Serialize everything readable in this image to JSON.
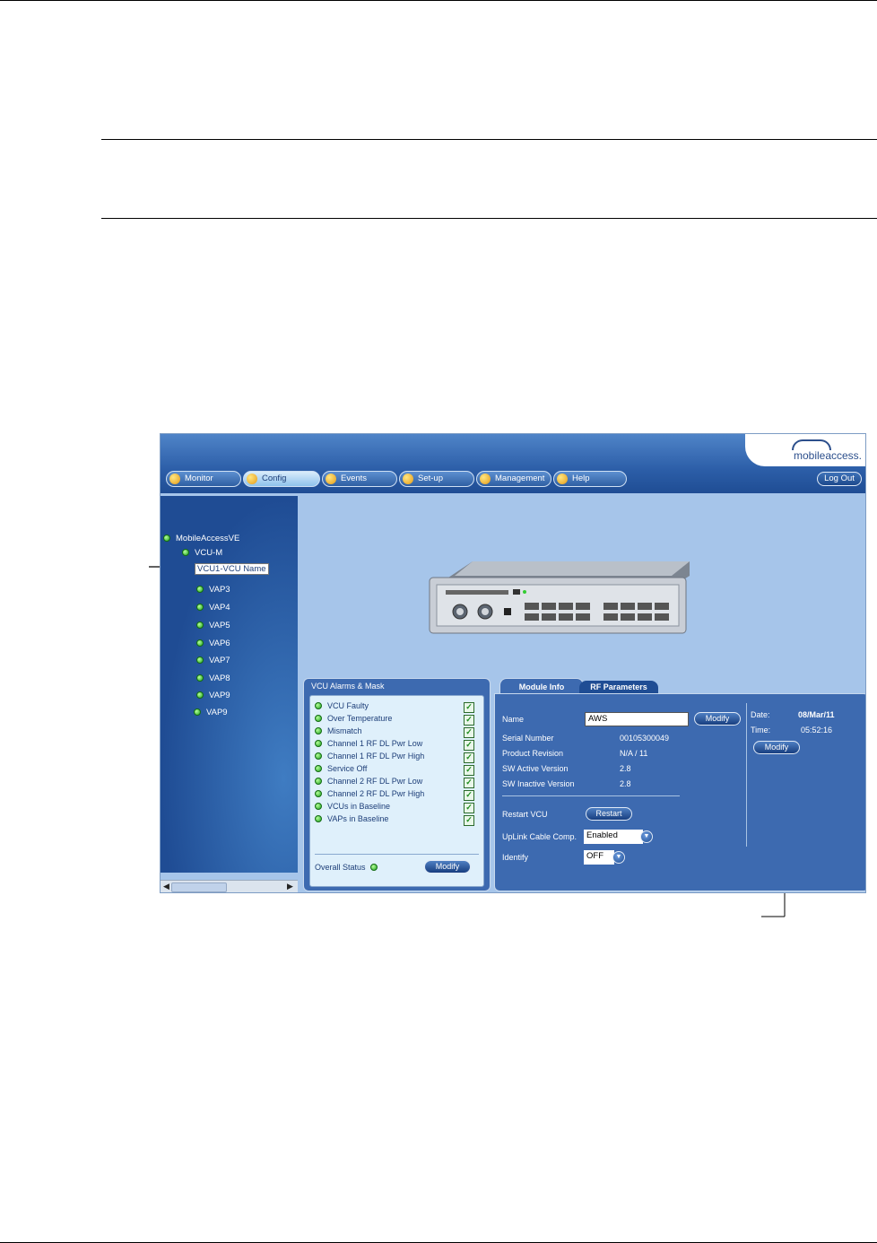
{
  "tabs": [
    {
      "label": "Monitor"
    },
    {
      "label": "Config"
    },
    {
      "label": "Events"
    },
    {
      "label": "Set-up"
    },
    {
      "label": "Management"
    },
    {
      "label": "Help"
    }
  ],
  "logo_text": "mobileaccess.",
  "logout_label": "Log Out",
  "tree": {
    "root": "MobileAccessVE",
    "vcu_m": "VCU-M",
    "selected": "VCU1-VCU Name",
    "vaps": [
      "VAP3",
      "VAP4",
      "VAP5",
      "VAP6",
      "VAP7",
      "VAP8",
      "VAP9",
      "VAP9"
    ]
  },
  "alarms": {
    "title": "VCU Alarms & Mask",
    "items": [
      {
        "label": "VCU Faulty",
        "checked": true
      },
      {
        "label": "Over Temperature",
        "checked": true
      },
      {
        "label": "Mismatch",
        "checked": true
      },
      {
        "label": "Channel 1 RF DL Pwr Low",
        "checked": true
      },
      {
        "label": "Channel 1 RF DL Pwr High",
        "checked": true
      },
      {
        "label": "Service Off",
        "checked": true
      },
      {
        "label": "Channel 2 RF DL Pwr Low",
        "checked": true
      },
      {
        "label": "Channel 2 RF DL Pwr High",
        "checked": true
      },
      {
        "label": "VCUs in Baseline",
        "checked": true
      },
      {
        "label": "VAPs in Baseline",
        "checked": true
      }
    ],
    "overall_label": "Overall Status",
    "modify_label": "Modify"
  },
  "module": {
    "tab_info": "Module Info",
    "tab_rf": "RF Parameters",
    "name_label": "Name",
    "name_value": "AWS",
    "modify_label": "Modify",
    "serial_label": "Serial Number",
    "serial_value": "00105300049",
    "product_label": "Product Revision",
    "product_value": "N/A / 11",
    "sw_active_label": "SW Active Version",
    "sw_active_value": "2.8",
    "sw_inactive_label": "SW Inactive Version",
    "sw_inactive_value": "2.8",
    "restart_label": "Restart VCU",
    "restart_button": "Restart",
    "uplink_label": "UpLink Cable Comp.",
    "uplink_value": "Enabled",
    "identify_label": "Identify",
    "identify_value": "OFF",
    "date_label": "Date:",
    "date_value": "08/Mar/11",
    "time_label": "Time:",
    "time_value": "05:52:16",
    "datetime_modify": "Modify"
  }
}
